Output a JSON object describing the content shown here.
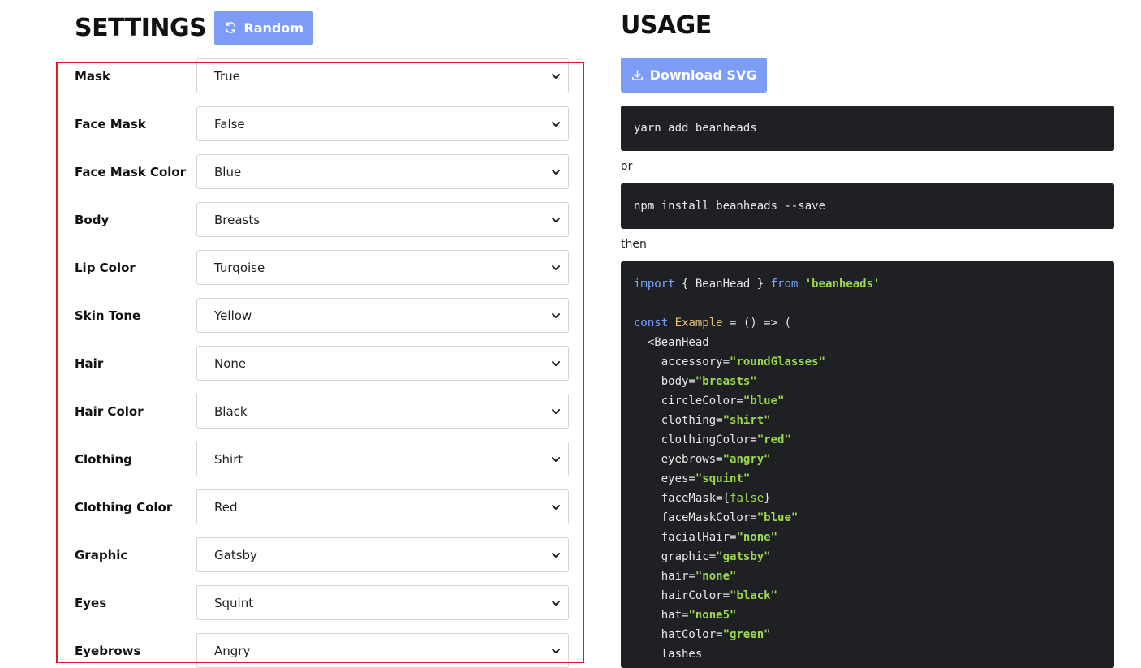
{
  "settings": {
    "title": "SETTINGS",
    "random_label": "Random",
    "rows": [
      {
        "label": "Mask",
        "value": "True"
      },
      {
        "label": "Face Mask",
        "value": "False"
      },
      {
        "label": "Face Mask Color",
        "value": "Blue"
      },
      {
        "label": "Body",
        "value": "Breasts"
      },
      {
        "label": "Lip Color",
        "value": "Turqoise"
      },
      {
        "label": "Skin Tone",
        "value": "Yellow"
      },
      {
        "label": "Hair",
        "value": "None"
      },
      {
        "label": "Hair Color",
        "value": "Black"
      },
      {
        "label": "Clothing",
        "value": "Shirt"
      },
      {
        "label": "Clothing Color",
        "value": "Red"
      },
      {
        "label": "Graphic",
        "value": "Gatsby"
      },
      {
        "label": "Eyes",
        "value": "Squint"
      },
      {
        "label": "Eyebrows",
        "value": "Angry"
      }
    ]
  },
  "usage": {
    "title": "USAGE",
    "download_label": "Download SVG",
    "yarn_cmd": "yarn add beanheads",
    "or_text": "or",
    "npm_cmd": "npm install beanheads --save",
    "then_text": "then",
    "code": {
      "import_kw": "import",
      "import_mid": " { BeanHead } ",
      "from_kw": "from",
      "import_src": "'beanheads'",
      "const_kw": "const",
      "component_name": "Example",
      "arrow": " = () => (",
      "open_tag": "  <BeanHead",
      "props": [
        {
          "name": "accessory",
          "value": "\"roundGlasses\"",
          "kind": "string"
        },
        {
          "name": "body",
          "value": "\"breasts\"",
          "kind": "string"
        },
        {
          "name": "circleColor",
          "value": "\"blue\"",
          "kind": "string"
        },
        {
          "name": "clothing",
          "value": "\"shirt\"",
          "kind": "string"
        },
        {
          "name": "clothingColor",
          "value": "\"red\"",
          "kind": "string"
        },
        {
          "name": "eyebrows",
          "value": "\"angry\"",
          "kind": "string"
        },
        {
          "name": "eyes",
          "value": "\"squint\"",
          "kind": "string"
        },
        {
          "name": "faceMask",
          "value": "{false}",
          "kind": "bool"
        },
        {
          "name": "faceMaskColor",
          "value": "\"blue\"",
          "kind": "string"
        },
        {
          "name": "facialHair",
          "value": "\"none\"",
          "kind": "string"
        },
        {
          "name": "graphic",
          "value": "\"gatsby\"",
          "kind": "string"
        },
        {
          "name": "hair",
          "value": "\"none\"",
          "kind": "string"
        },
        {
          "name": "hairColor",
          "value": "\"black\"",
          "kind": "string"
        },
        {
          "name": "hat",
          "value": "\"none5\"",
          "kind": "string"
        },
        {
          "name": "hatColor",
          "value": "\"green\"",
          "kind": "string"
        },
        {
          "name": "lashes",
          "value": "",
          "kind": "none"
        }
      ]
    }
  },
  "colors": {
    "accent_button": "#7c9cf5",
    "highlight_border": "#e01c1c",
    "code_bg": "#1f2023",
    "code_keyword": "#7aa7ff",
    "code_string": "#9bd94c",
    "code_component": "#e5c07b"
  },
  "icons": {
    "random": "refresh-icon",
    "download": "download-icon",
    "select": "chevron-down-icon"
  }
}
